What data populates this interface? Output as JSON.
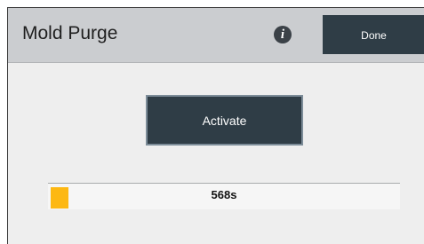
{
  "dialog": {
    "title": "Mold Purge",
    "info_icon": "info-icon",
    "done_label": "Done"
  },
  "actions": {
    "activate_label": "Activate"
  },
  "progress": {
    "value_text": "568s",
    "fill_fraction": 0.05,
    "fill_color": "#fdb813"
  },
  "colors": {
    "header_bg": "#cbcdd0",
    "button_bg": "#2f3d46",
    "body_bg": "#eeeeee"
  }
}
